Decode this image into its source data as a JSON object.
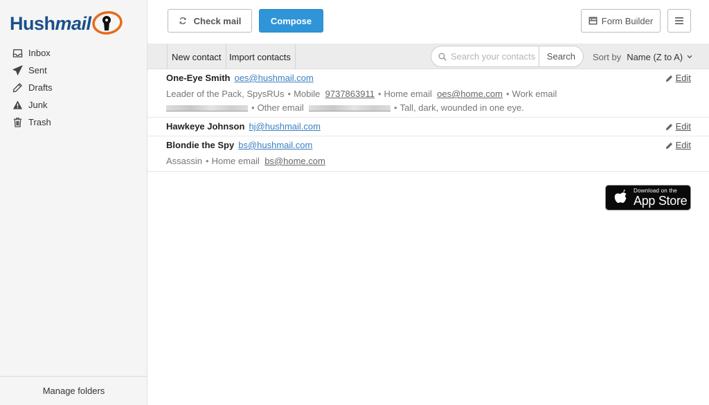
{
  "brand": {
    "logo_part1": "Hush",
    "logo_part2": "mail",
    "primary_color": "#1b4f8a",
    "accent_color": "#e86a1a"
  },
  "sidebar": {
    "folders": [
      {
        "label": "Inbox",
        "icon": "inbox-icon"
      },
      {
        "label": "Sent",
        "icon": "paper-plane-icon"
      },
      {
        "label": "Drafts",
        "icon": "pencil-icon"
      },
      {
        "label": "Junk",
        "icon": "warning-icon"
      },
      {
        "label": "Trash",
        "icon": "trash-icon"
      }
    ],
    "manage_label": "Manage folders"
  },
  "topbar": {
    "check_mail": "Check mail",
    "compose": "Compose",
    "form_builder": "Form Builder",
    "compose_color": "#2f95d8"
  },
  "toolbar": {
    "new_contact": "New contact",
    "import_contacts": "Import contacts",
    "search_placeholder": "Search your contacts",
    "search_button": "Search",
    "sort_label": "Sort by",
    "sort_value": "Name (Z to A)"
  },
  "contacts": [
    {
      "name": "One-Eye Smith",
      "email": "oes@hushmail.com",
      "title": "Leader of the Pack, SpysRUs",
      "mobile_label": "Mobile",
      "mobile": "9737863911",
      "home_email_label": "Home email",
      "home_email": "oes@home.com",
      "work_email_label": "Work email",
      "other_email_label": "Other email",
      "note": "Tall, dark, wounded in one eye.",
      "edit": "Edit"
    },
    {
      "name": "Hawkeye Johnson",
      "email": "hj@hushmail.com",
      "edit": "Edit"
    },
    {
      "name": "Blondie the Spy",
      "email": "bs@hushmail.com",
      "title": "Assassin",
      "home_email_label": "Home email",
      "home_email": "bs@home.com",
      "edit": "Edit"
    }
  ],
  "appstore": {
    "small": "Download on the",
    "big": "App Store"
  }
}
